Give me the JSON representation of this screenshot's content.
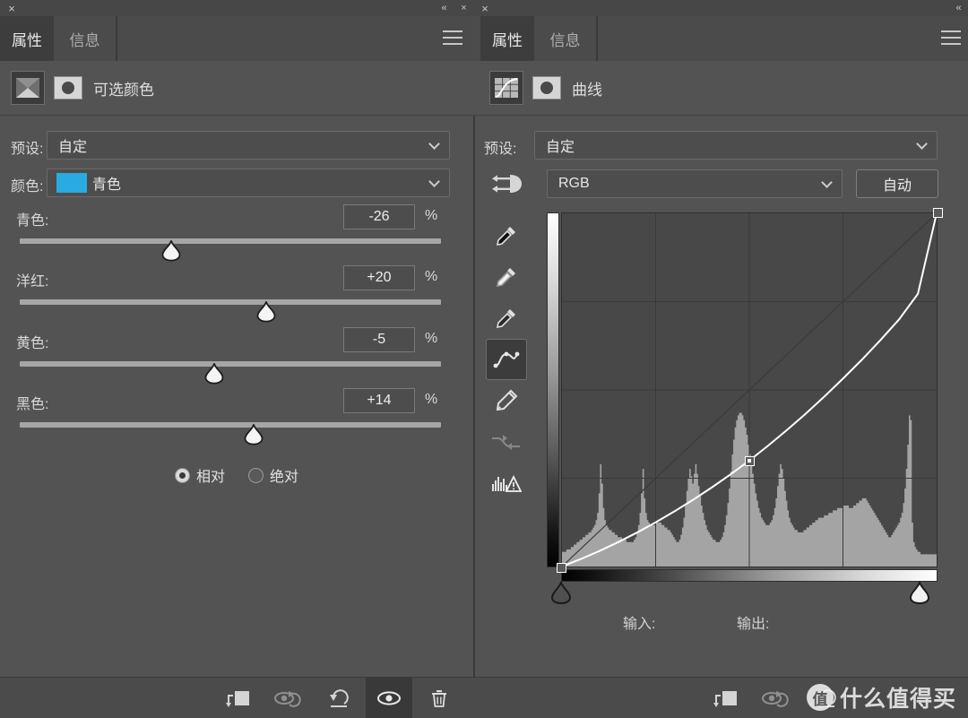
{
  "window": {
    "close_label": "×",
    "collapse_label": "«"
  },
  "left_panel": {
    "tabs": [
      {
        "label": "属性",
        "active": true
      },
      {
        "label": "信息",
        "active": false
      }
    ],
    "adjustment_title": "可选颜色",
    "preset": {
      "label": "预设:",
      "value": "自定"
    },
    "color": {
      "label": "颜色:",
      "value": "青色",
      "swatch_hex": "#29abe2"
    },
    "sliders": [
      {
        "label": "青色:",
        "value": "-26",
        "unit": "%",
        "percent": 36.0
      },
      {
        "label": "洋红:",
        "value": "+20",
        "unit": "%",
        "percent": 58.5
      },
      {
        "label": "黄色:",
        "value": "-5",
        "unit": "%",
        "percent": 46.2
      },
      {
        "label": "黑色:",
        "value": "+14",
        "unit": "%",
        "percent": 55.5
      }
    ],
    "method": [
      {
        "label": "相对",
        "selected": true
      },
      {
        "label": "绝对",
        "selected": false
      }
    ],
    "bottom_tools": [
      {
        "name": "clip-to-layer",
        "selected": false
      },
      {
        "name": "view-previous-state",
        "selected": false
      },
      {
        "name": "reset",
        "selected": false
      },
      {
        "name": "toggle-visibility",
        "selected": true
      },
      {
        "name": "delete",
        "selected": false
      }
    ]
  },
  "right_panel": {
    "tabs": [
      {
        "label": "属性",
        "active": true
      },
      {
        "label": "信息",
        "active": false
      }
    ],
    "adjustment_title": "曲线",
    "preset": {
      "label": "预设:",
      "value": "自定"
    },
    "channel": {
      "value": "RGB"
    },
    "auto_button": "自动",
    "tools": [
      {
        "name": "black-point-eyedropper",
        "active": false,
        "dim": false
      },
      {
        "name": "gray-point-eyedropper",
        "active": false,
        "dim": false
      },
      {
        "name": "white-point-eyedropper",
        "active": false,
        "dim": false
      },
      {
        "name": "curve-point-tool",
        "active": true,
        "dim": false
      },
      {
        "name": "pencil-draw-tool",
        "active": false,
        "dim": false
      },
      {
        "name": "smooth-curve-tool",
        "active": false,
        "dim": true
      },
      {
        "name": "histogram-warning",
        "active": false,
        "dim": false
      }
    ],
    "input_label": "输入:",
    "output_label": "输出:",
    "input_value": "",
    "output_value": "",
    "bottom_tools": [
      {
        "name": "clip-to-layer",
        "selected": false
      },
      {
        "name": "view-previous-state",
        "selected": false
      },
      {
        "name": "reset",
        "selected": false
      }
    ]
  },
  "watermark": {
    "logo_char": "值",
    "text": "什么值得买"
  },
  "chart_data": {
    "type": "line",
    "title": "RGB Tone Curve",
    "xlabel": "Input",
    "ylabel": "Output",
    "xlim": [
      0,
      255
    ],
    "ylim": [
      0,
      255
    ],
    "grid": "4x4",
    "control_points": [
      {
        "input": 0,
        "output": 0
      },
      {
        "input": 128,
        "output": 96
      },
      {
        "input": 255,
        "output": 255
      }
    ],
    "baseline": {
      "from": [
        0,
        0
      ],
      "to": [
        255,
        255
      ]
    },
    "curve_path_percent": [
      [
        0,
        0
      ],
      [
        5,
        2.1
      ],
      [
        10,
        4.4
      ],
      [
        15,
        6.9
      ],
      [
        20,
        9.6
      ],
      [
        25,
        12.5
      ],
      [
        30,
        15.6
      ],
      [
        35,
        18.9
      ],
      [
        40,
        22.4
      ],
      [
        45,
        26.1
      ],
      [
        50,
        30.0
      ],
      [
        55,
        34.2
      ],
      [
        60,
        38.6
      ],
      [
        65,
        43.2
      ],
      [
        70,
        48.1
      ],
      [
        75,
        53.2
      ],
      [
        80,
        58.5
      ],
      [
        85,
        64.1
      ],
      [
        90,
        70.0
      ],
      [
        95,
        77.2
      ],
      [
        100,
        100
      ]
    ],
    "histogram_values": [
      6,
      6,
      6,
      7,
      7,
      7,
      8,
      8,
      9,
      9,
      10,
      10,
      11,
      11,
      12,
      12,
      13,
      13,
      14,
      14,
      15,
      16,
      17,
      19,
      22,
      30,
      42,
      34,
      24,
      19,
      17,
      16,
      15,
      15,
      14,
      14,
      13,
      13,
      12,
      12,
      12,
      11,
      11,
      11,
      10,
      10,
      10,
      10,
      10,
      11,
      12,
      14,
      17,
      22,
      30,
      40,
      28,
      22,
      19,
      18,
      17,
      17,
      17,
      17,
      18,
      18,
      18,
      18,
      17,
      17,
      16,
      16,
      15,
      15,
      14,
      13,
      12,
      11,
      10,
      10,
      11,
      13,
      16,
      20,
      25,
      31,
      36,
      40,
      37,
      34,
      38,
      42,
      38,
      33,
      29,
      25,
      22,
      19,
      17,
      15,
      14,
      13,
      12,
      11,
      11,
      10,
      10,
      10,
      11,
      12,
      14,
      17,
      21,
      26,
      32,
      39,
      46,
      52,
      57,
      60,
      62,
      63,
      63,
      62,
      60,
      57,
      54,
      50,
      46,
      42,
      38,
      34,
      30,
      27,
      24,
      22,
      20,
      19,
      18,
      17,
      17,
      17,
      18,
      19,
      21,
      24,
      28,
      33,
      38,
      42,
      40,
      36,
      31,
      27,
      23,
      20,
      18,
      17,
      16,
      15,
      15,
      14,
      14,
      14,
      14,
      15,
      15,
      16,
      16,
      17,
      17,
      18,
      18,
      19,
      19,
      20,
      20,
      20,
      20,
      21,
      21,
      21,
      22,
      22,
      22,
      23,
      23,
      23,
      24,
      24,
      24,
      24,
      25,
      25,
      25,
      25,
      24,
      24,
      24,
      25,
      25,
      26,
      26,
      27,
      27,
      28,
      28,
      28,
      27,
      26,
      25,
      24,
      23,
      22,
      21,
      20,
      19,
      18,
      17,
      16,
      15,
      14,
      13,
      12,
      12,
      13,
      14,
      15,
      16,
      17,
      18,
      20,
      22,
      26,
      32,
      40,
      50,
      62,
      60,
      18,
      10,
      8,
      7,
      6,
      6,
      5,
      5,
      5,
      5,
      5,
      5,
      5,
      5,
      5,
      5,
      5
    ]
  }
}
